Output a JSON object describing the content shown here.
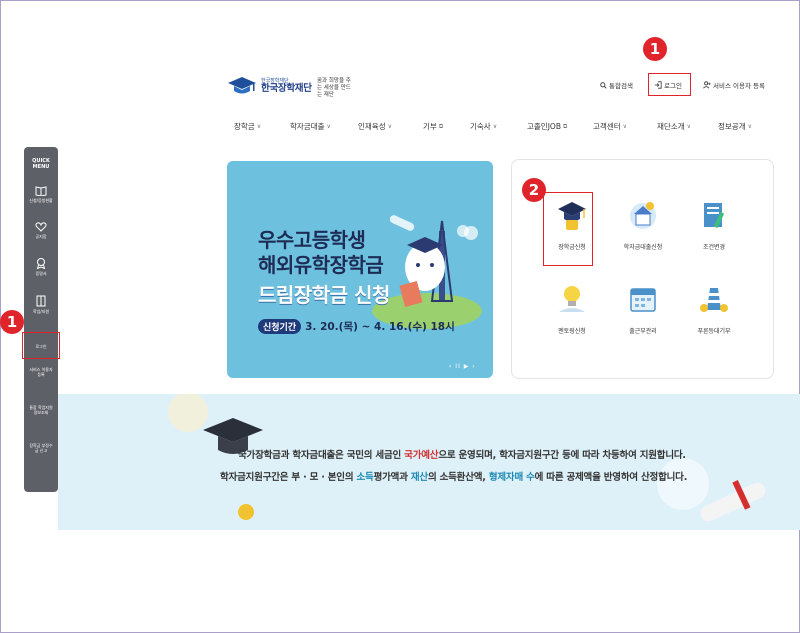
{
  "header": {
    "logo": {
      "small_text": "한국장학재단",
      "main_text": "한국장학재단",
      "slogan": "꿈과 희망을 주는 세상을 만드는 재단"
    },
    "util": {
      "search_label": "통합검색",
      "login_label": "로그인",
      "register_label": "서비스 이용자 등록"
    }
  },
  "nav": {
    "items": [
      {
        "label": "장학금",
        "has_chevron": true
      },
      {
        "label": "학자금대출",
        "has_chevron": true
      },
      {
        "label": "인재육성",
        "has_chevron": true
      },
      {
        "label": "기부",
        "has_external": true
      },
      {
        "label": "기숙사",
        "has_chevron": true
      },
      {
        "label": "고졸인JOB",
        "has_external": true
      },
      {
        "label": "고객센터",
        "has_chevron": true
      },
      {
        "label": "재단소개",
        "has_chevron": true
      },
      {
        "label": "정보공개",
        "has_chevron": true
      }
    ]
  },
  "quick_menu": {
    "title": "QUICK MENU",
    "items": [
      {
        "label": "신청/증빙현황",
        "icon": "book-icon"
      },
      {
        "label": "공지함",
        "icon": "heart-icon"
      },
      {
        "label": "증명서",
        "icon": "badge-icon"
      },
      {
        "label": "학업/지원",
        "icon": "building-icon"
      },
      {
        "label": "로그인",
        "icon": ""
      },
      {
        "label": "서비스 이용자 등록",
        "icon": ""
      },
      {
        "label": "통합 학업지원 정보조회",
        "icon": ""
      },
      {
        "label": "장학금 부정수급 신고",
        "icon": ""
      }
    ]
  },
  "banner": {
    "line1": "우수고등학생",
    "line2": "해외유학장학금",
    "line3": "드림장학금 신청",
    "period_label": "신청기간",
    "period_value": "3. 20.(목) ~ 4. 16.(수) 18시",
    "controls": "‹ II ▶ ›",
    "bg_color": "#6ec1de"
  },
  "services": [
    {
      "label": "장학금신청",
      "icon": "graduation-cap-icon"
    },
    {
      "label": "학자금대출신청",
      "icon": "money-house-icon"
    },
    {
      "label": "조건변경",
      "icon": "document-edit-icon"
    },
    {
      "label": "멘토링신청",
      "icon": "lightbulb-icon"
    },
    {
      "label": "출근부관리",
      "icon": "calendar-icon"
    },
    {
      "label": "푸른등대기부",
      "icon": "lighthouse-icon"
    }
  ],
  "info": {
    "l1_a": "국가장학금과 학자금대출은 국민의 세금인 ",
    "l1_hl": "국가예산",
    "l1_b": "으로 운영되며, 학자금지원구간 등에 따라 차등하여 지원합니다.",
    "l2_a": "학자금지원구간은 부 · 모 · 본인의 ",
    "l2_hl1": "소득",
    "l2_b": "평가액과 ",
    "l2_hl2": "재산",
    "l2_c": "의 소득환산액, ",
    "l2_hl3": "형제자매 수",
    "l2_d": "에 따른 공제액을 반영하여 산정합니다."
  },
  "annotations": {
    "badge_1_top": "1",
    "badge_1_left": "1",
    "badge_2": "2",
    "accent_color": "#e0242b"
  }
}
